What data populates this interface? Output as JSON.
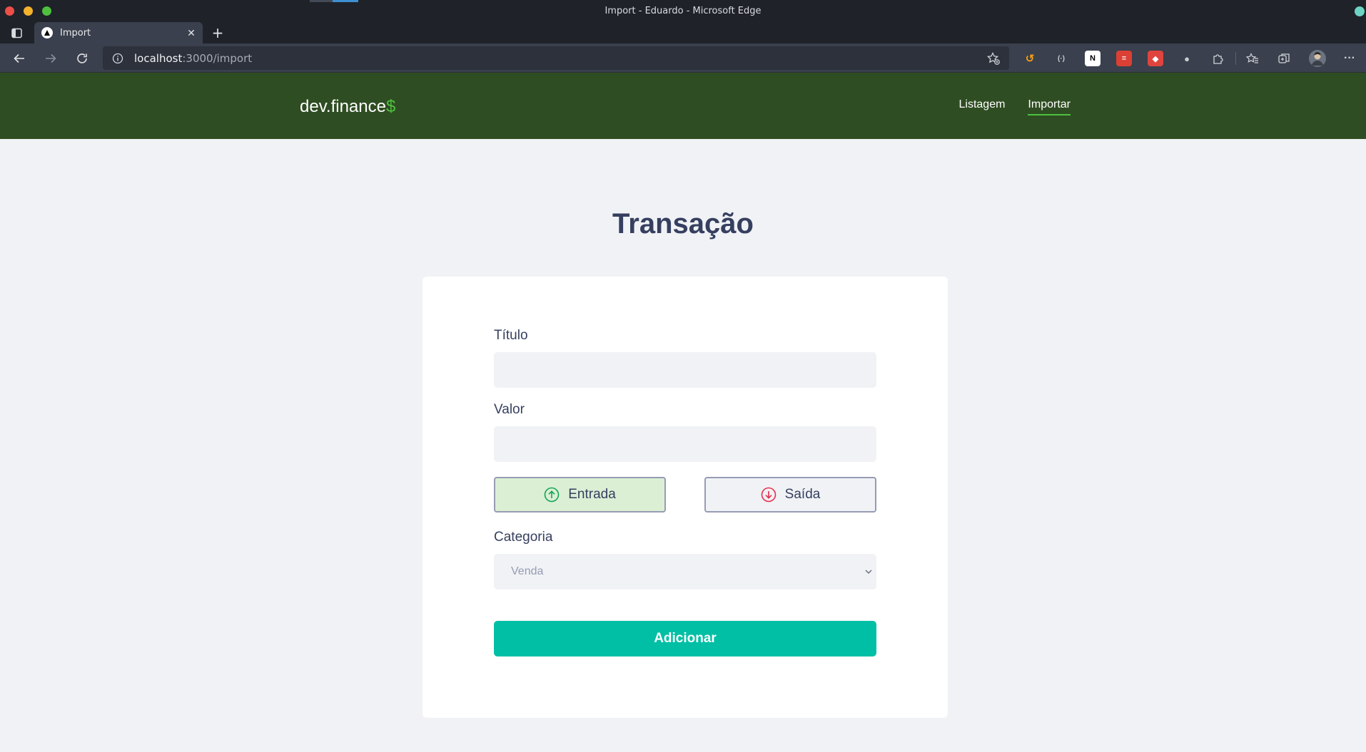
{
  "window": {
    "title": "Import - Eduardo - Microsoft Edge"
  },
  "tabs": [
    {
      "label": "Import",
      "active": true
    }
  ],
  "address_bar": {
    "host": "localhost",
    "path": ":3000/import"
  },
  "app": {
    "brand_text": "dev.finance",
    "brand_symbol": "$",
    "nav": [
      {
        "label": "Listagem",
        "active": false
      },
      {
        "label": "Importar",
        "active": true
      }
    ]
  },
  "form": {
    "page_title": "Transação",
    "title_label": "Título",
    "title_value": "",
    "value_label": "Valor",
    "value_value": "",
    "income_label": "Entrada",
    "outcome_label": "Saída",
    "selected_type": "income",
    "category_label": "Categoria",
    "category_selected": "Venda",
    "submit_label": "Adicionar"
  },
  "colors": {
    "header_bg": "#2f4d22",
    "accent_green": "#4dc23f",
    "title_text": "#363f5f",
    "submit_bg": "#00bfa5",
    "income_bg": "#dbefd5",
    "outcome_icon": "#e52e4d",
    "income_icon": "#12a454"
  },
  "icons": {
    "income": "arrow-up-circle-icon",
    "outcome": "arrow-down-circle-icon",
    "select": "chevron-down-icon"
  }
}
